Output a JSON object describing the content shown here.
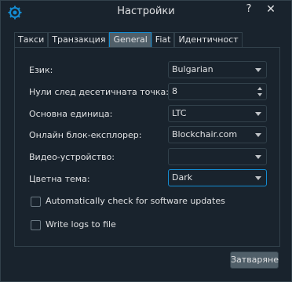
{
  "window": {
    "title": "Настройки",
    "help_glyph": "?",
    "close_glyph": "✕",
    "icon": "gear-icon"
  },
  "tabs": [
    {
      "label": "Такси",
      "active": false
    },
    {
      "label": "Транзакция",
      "active": false
    },
    {
      "label": "General",
      "active": true
    },
    {
      "label": "Fiat",
      "active": false
    },
    {
      "label": "Идентичност",
      "active": false
    }
  ],
  "general": {
    "language": {
      "label": "Език:",
      "value": "Bulgarian"
    },
    "decimal_zeros": {
      "label": "Нули след десетичната точка:",
      "value": "8"
    },
    "base_unit": {
      "label": "Основна единица:",
      "value": "LTC"
    },
    "block_explorer": {
      "label": "Онлайн блок-експлорер:",
      "value": "Blockchair.com"
    },
    "video_device": {
      "label": "Видео-устройство:",
      "value": ""
    },
    "color_theme": {
      "label": "Цветна тема:",
      "value": "Dark"
    },
    "auto_update": {
      "label": "Automatically check for software updates",
      "checked": false
    },
    "write_logs": {
      "label": "Write logs to file",
      "checked": false
    }
  },
  "footer": {
    "close_label": "Затваряне"
  },
  "colors": {
    "background": "#19232d",
    "border": "#32414b",
    "accent": "#148cd2",
    "text": "#e0e1e3"
  }
}
